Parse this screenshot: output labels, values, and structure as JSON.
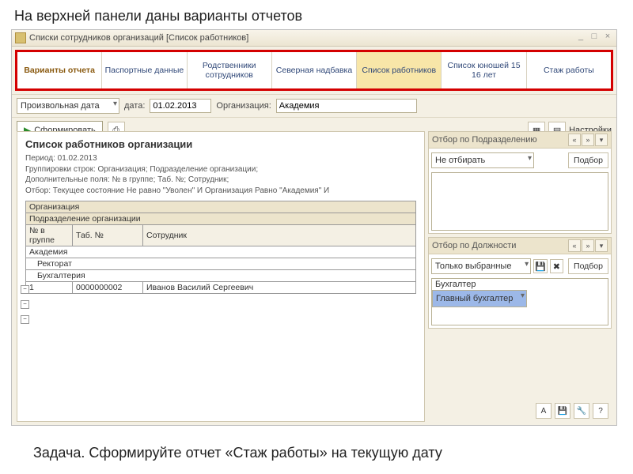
{
  "slide": {
    "title": "На верхней панели даны варианты отчетов",
    "task": "Задача. Сформируйте отчет «Стаж работы» на текущую дату"
  },
  "window": {
    "title": "Списки сотрудников организаций [Список работников]"
  },
  "variants": {
    "header": "Варианты отчета",
    "items": [
      "Паспортные данные",
      "Родственники сотрудников",
      "Северная надбавка",
      "Список работников",
      "Список юношей 15 16 лет",
      "Стаж работы"
    ],
    "active": "Список работников"
  },
  "filter": {
    "date_mode": "Произвольная дата",
    "date_label": "дата:",
    "date_value": "01.02.2013",
    "org_label": "Организация:",
    "org_value": "Академия"
  },
  "actions": {
    "form": "Сформировать",
    "settings": "Настройки"
  },
  "report": {
    "title": "Список работников организации",
    "period": "Период: 01.02.2013",
    "groupings": "Группировки строк: Организация; Подразделение организации;",
    "extra": "Дополнительные поля: № в группе; Таб. №; Сотрудник;",
    "filter_line": "Отбор: Текущее состояние Не равно \"Уволен\" И Организация Равно \"Академия\" И ",
    "col": {
      "org": "Организация",
      "dept": "Подразделение организации",
      "num": "№ в группе",
      "tab": "Таб. №",
      "emp": "Сотрудник"
    },
    "rows": {
      "org": "Академия",
      "dept1": "Ректорат",
      "dept2": "Бухгалтерия",
      "r1": {
        "num": "1",
        "tab": "0000000002",
        "emp": "Иванов Василий Сергеевич"
      }
    }
  },
  "panel_dept": {
    "title": "Отбор по Подразделению",
    "mode": "Не отбирать",
    "pick": "Подбор"
  },
  "panel_pos": {
    "title": "Отбор по Должности",
    "mode": "Только выбранные",
    "pick": "Подбор",
    "items": [
      "Бухгалтер",
      "Главный бухгалтер"
    ],
    "selected": "Главный бухгалтер"
  }
}
